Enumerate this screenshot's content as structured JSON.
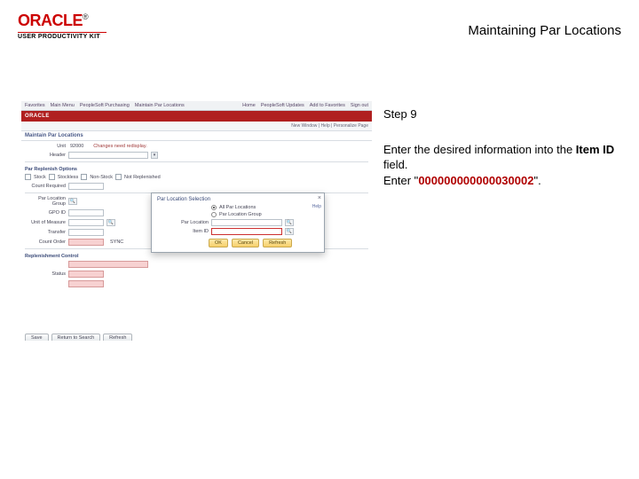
{
  "header": {
    "brand": "ORACLE",
    "reg": "®",
    "subline": "USER PRODUCTIVITY KIT",
    "page_title": "Maintaining Par Locations"
  },
  "instructions": {
    "step_label": "Step 9",
    "line1a": "Enter the desired information into the ",
    "line1b_bold": "Item ID",
    "line1c": " field.",
    "line2a": "Enter \"",
    "line2_value": "000000000000030002",
    "line2b": "\"."
  },
  "shot": {
    "topnav": [
      "Favorites",
      "Main Menu",
      "PeopleSoft Purchasing",
      "Maintain Par Locations",
      "Home",
      "PeopleSoft Updates",
      "Add to Favorites",
      "Sign out"
    ],
    "brand": "ORACLE",
    "crumb": "New Window | Help | Personalize Page",
    "title_bar": "Maintain Par Locations",
    "changes_note": "Changes need redisplay.",
    "labels": {
      "unit": "Unit",
      "header": "Header",
      "subsection": "Par Replenish Options",
      "stock": "Stock",
      "stockless": "Stockless",
      "nonstock": "Non-Stock",
      "not_replenished": "Not Replenished",
      "count_req": "Count Required",
      "par_group": "Par Location Group",
      "gpo": "GPO ID",
      "unit_of_measure": "Unit of Measure",
      "count_order": "Count Order",
      "transfer": "Transfer",
      "sync": "SYNC",
      "repl_ctrl": "Replenishment Control",
      "status": "Status",
      "foot_save": "Save",
      "foot_return": "Return to Search",
      "foot_refresh": "Refresh"
    },
    "unit_value": "92000",
    "dialog": {
      "title": "Par Location Selection",
      "opt1": "All Par Locations",
      "opt2": "Par Location Group",
      "par_loc": "Par Location",
      "item_id": "Item ID",
      "ok": "OK",
      "cancel": "Cancel",
      "refresh": "Refresh",
      "help": "Help",
      "close": "×"
    }
  }
}
